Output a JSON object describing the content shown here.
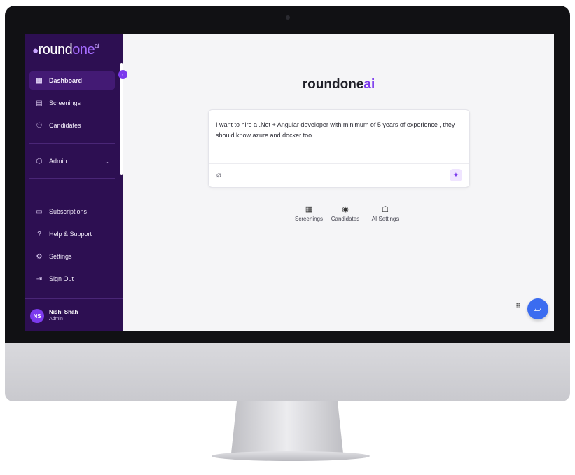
{
  "sidebar": {
    "logo": {
      "dot": "●",
      "round": "round",
      "one": "one",
      "sup": "ai"
    },
    "items": [
      {
        "label": "Dashboard",
        "icon": "dashboard-grid-icon",
        "glyph": "▦"
      },
      {
        "label": "Screenings",
        "icon": "document-icon",
        "glyph": "▤"
      },
      {
        "label": "Candidates",
        "icon": "users-icon",
        "glyph": "⚇"
      },
      {
        "label": "Admin",
        "icon": "shield-icon",
        "glyph": "⬡"
      },
      {
        "label": "Subscriptions",
        "icon": "card-icon",
        "glyph": "▭"
      },
      {
        "label": "Help & Support",
        "icon": "help-icon",
        "glyph": "?"
      },
      {
        "label": "Settings",
        "icon": "gear-icon",
        "glyph": "⚙"
      },
      {
        "label": "Sign Out",
        "icon": "sign-out-icon",
        "glyph": "⇥"
      }
    ],
    "collapse_glyph": "‹",
    "chevron_glyph": "⌄",
    "user": {
      "initials": "NS",
      "name": "Nishi Shah",
      "role": "Admin"
    }
  },
  "main": {
    "brand": {
      "primary": "roundone",
      "accent": "ai"
    },
    "prompt": {
      "text": "I want to hire a .Net + Angular developer with minimum of 5 years of experience , they should know azure and docker too.",
      "attach_glyph": "⌀",
      "magic_glyph": "✦"
    },
    "quick_links": [
      {
        "label": "Screenings",
        "icon": "grid-icon",
        "glyph": "▦"
      },
      {
        "label": "Candidates",
        "icon": "user-circle-icon",
        "glyph": "◉"
      },
      {
        "label": "AI Settings",
        "icon": "robot-icon",
        "glyph": "☖"
      }
    ],
    "chat_glyph": "▱",
    "grip_glyph": "⠿"
  },
  "colors": {
    "sidebar": "#2d0f52",
    "accent": "#7c3aed",
    "fab": "#3b6cf0"
  }
}
